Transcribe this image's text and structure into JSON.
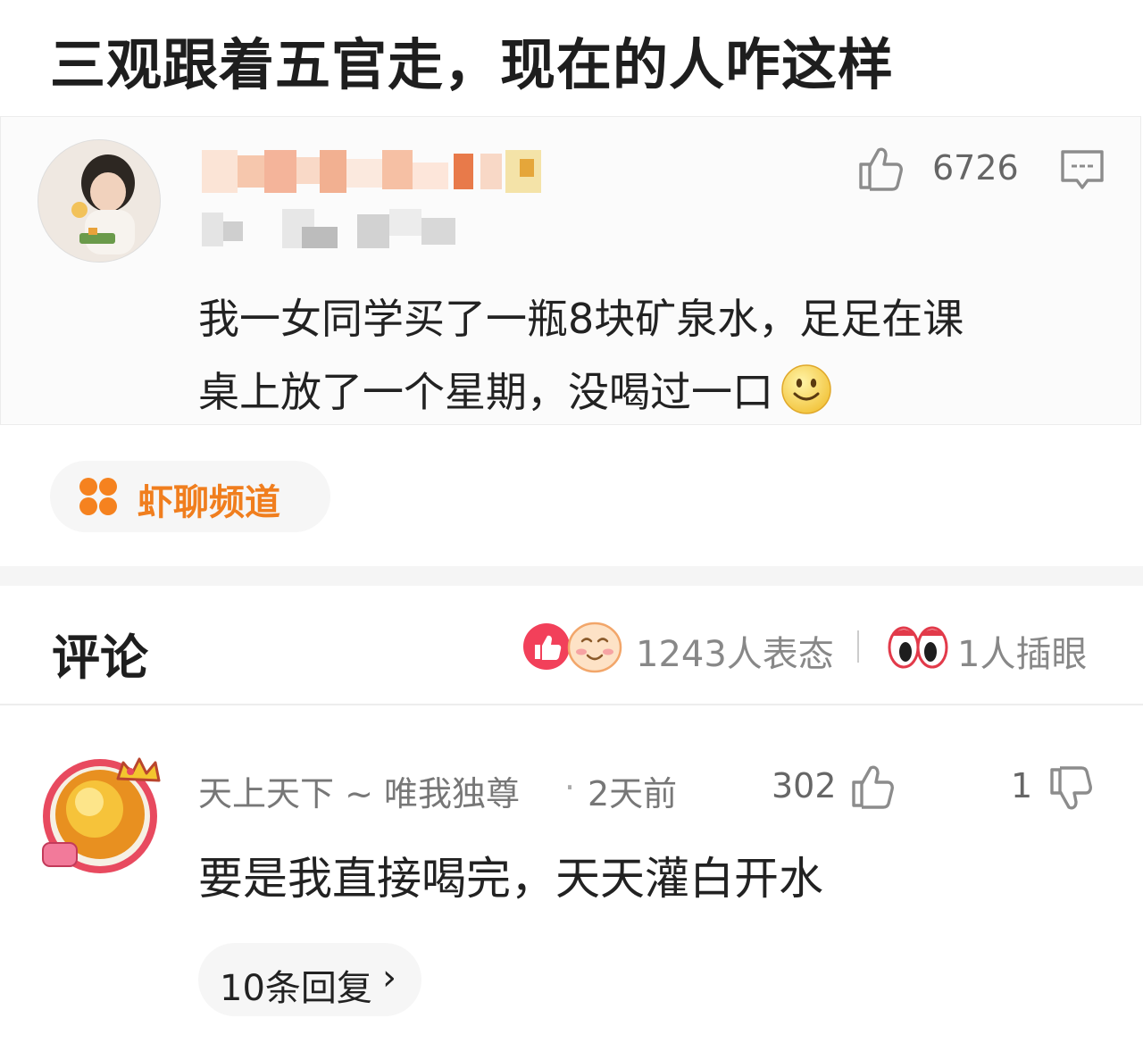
{
  "header": {
    "title": "三观跟着五官走，现在的人咋这样"
  },
  "post": {
    "like_count": "6726",
    "like_icon": "thumbs-up-outline-icon",
    "comment_icon": "comment-bubble-icon",
    "text_line1": "我一女同学买了一瓶8块矿泉水，足足在课",
    "text_line2": "桌上放了一个星期，没喝过一口",
    "emoji": "smile-emoji-icon"
  },
  "channel": {
    "label": "虾聊频道",
    "icon": "four-petal-grid-icon",
    "color": "#f07e1e"
  },
  "comments_header": {
    "title": "评论",
    "reactions_count": "1243人表态",
    "peek_count": "1人插眼"
  },
  "comment": {
    "username": "天上天下 ~ 唯我独尊",
    "dot": "·",
    "time": "2天前",
    "likes": "302",
    "dislikes": "1",
    "text": "要是我直接喝完，天天灌白开水",
    "replies_label": "10条回复",
    "replies_chevron": "›"
  }
}
